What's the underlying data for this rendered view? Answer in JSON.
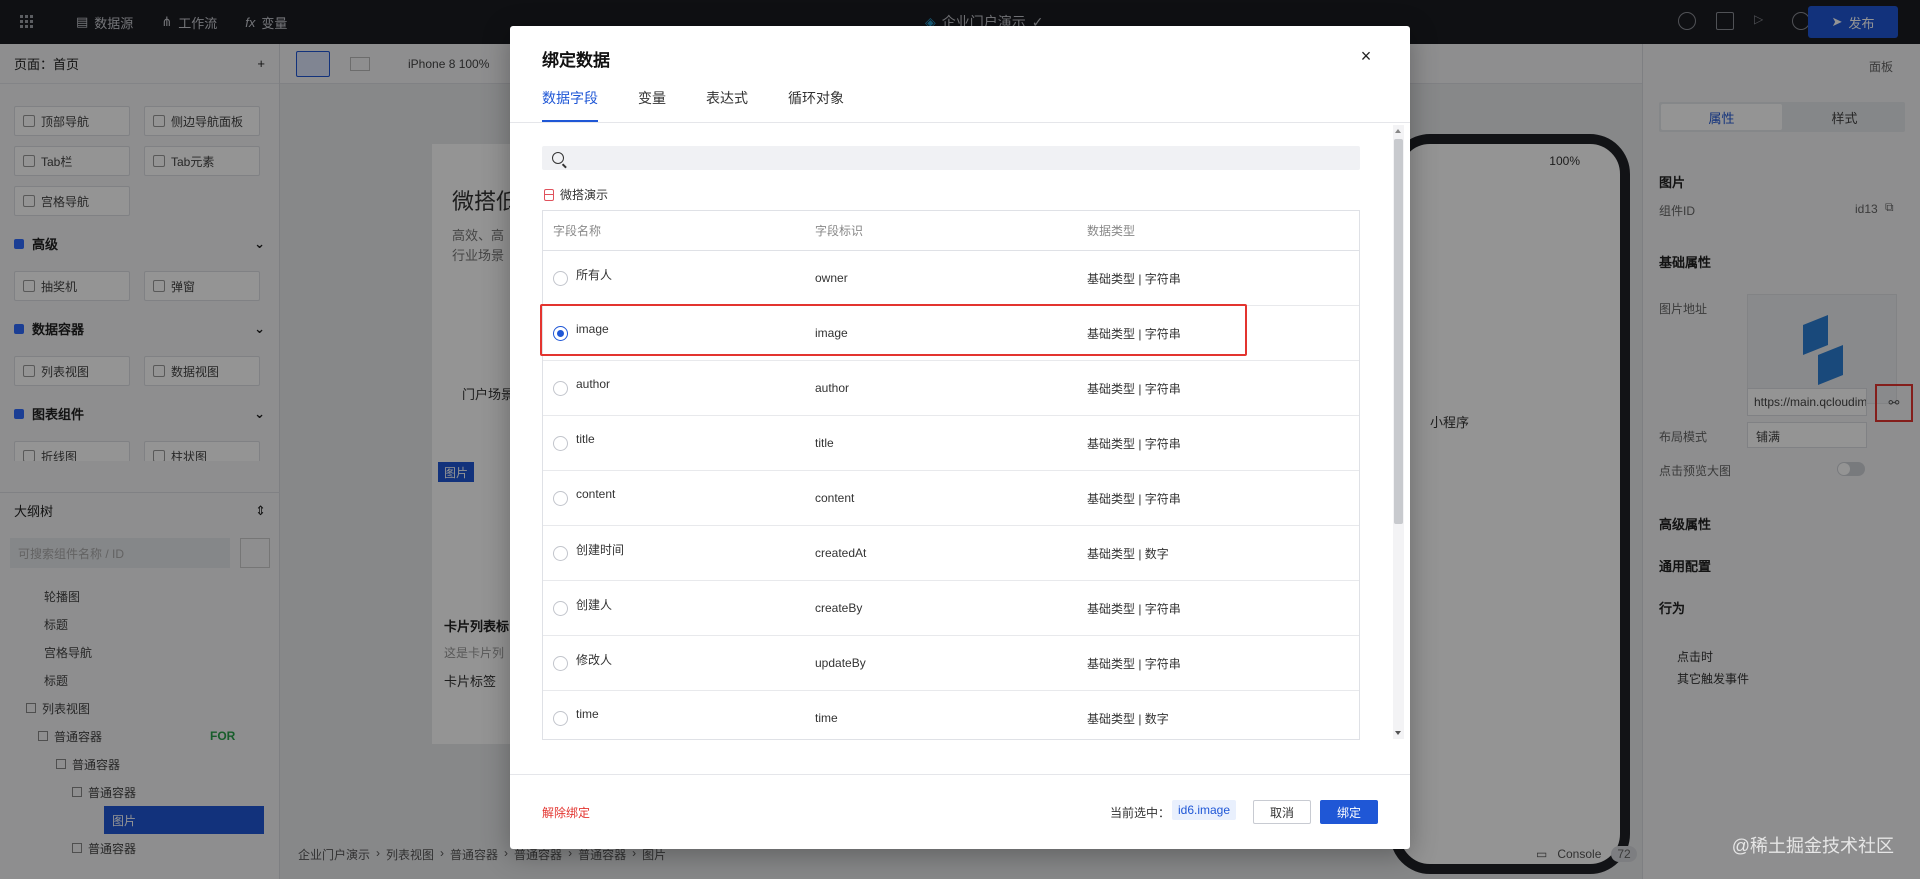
{
  "topbar": {
    "nav": [
      "数据源",
      "工作流",
      "变量"
    ],
    "app_title": "企业门户演示",
    "publish_label": "发布"
  },
  "left_panel": {
    "page_label": "页面：首页",
    "nav_components": [
      "顶部导航",
      "侧边导航面板",
      "Tab栏",
      "Tab元素",
      "宫格导航"
    ],
    "groups": [
      {
        "title": "高级",
        "items": [
          "抽奖机",
          "弹窗"
        ]
      },
      {
        "title": "数据容器",
        "items": [
          "列表视图",
          "数据视图"
        ]
      },
      {
        "title": "图表组件",
        "items": [
          "折线图",
          "柱状图"
        ]
      }
    ],
    "outline_title": "大纲树",
    "outline_search_placeholder": "可搜索组件名称 / ID",
    "tree": [
      "轮播图",
      "标题",
      "宫格导航",
      "标题",
      "列表视图",
      "普通容器",
      "普通容器",
      "普通容器",
      "图片",
      "普通容器"
    ],
    "for_tag": "FOR"
  },
  "canvas": {
    "device_label": "iPhone 8 100%",
    "hero_title": "微搭低",
    "hero_sub_1": "高效、高",
    "hero_sub_2": "行业场景",
    "portal_label": "门户场景",
    "mini_program_label": "小程序",
    "image_tag": "图片",
    "card_title": "卡片列表标",
    "card_desc": "这是卡片列",
    "card_label": "卡片标签",
    "phone_zoom": "100%"
  },
  "breadcrumb": [
    "企业门户演示",
    "列表视图",
    "普通容器",
    "普通容器",
    "普通容器",
    "图片"
  ],
  "console": {
    "label": "Console",
    "count": "72"
  },
  "right_panel": {
    "top_label": "面板",
    "tabs": [
      "属性",
      "样式"
    ],
    "section_title": "图片",
    "component_id_label": "组件ID",
    "component_id": "id13",
    "basic_props": "基础属性",
    "image_url_label": "图片地址",
    "image_url": "https://main.qcloudimg",
    "layout_mode_label": "布局模式",
    "layout_mode": "铺满",
    "preview_label": "点击预览大图",
    "advanced_props": "高级属性",
    "common_config": "通用配置",
    "behavior": "行为",
    "on_click": "点击时",
    "other_events": "其它触发事件"
  },
  "modal": {
    "title": "绑定数据",
    "close": "×",
    "tabs": [
      "数据字段",
      "变量",
      "表达式",
      "循环对象"
    ],
    "search_placeholder": "",
    "datasource_name": "微搭演示",
    "columns": [
      "字段名称",
      "字段标识",
      "数据类型"
    ],
    "rows": [
      {
        "name": "所有人",
        "id": "owner",
        "type": "基础类型 | 字符串",
        "checked": false
      },
      {
        "name": "image",
        "id": "image",
        "type": "基础类型 | 字符串",
        "checked": true
      },
      {
        "name": "author",
        "id": "author",
        "type": "基础类型 | 字符串",
        "checked": false
      },
      {
        "name": "title",
        "id": "title",
        "type": "基础类型 | 字符串",
        "checked": false
      },
      {
        "name": "content",
        "id": "content",
        "type": "基础类型 | 字符串",
        "checked": false
      },
      {
        "name": "创建时间",
        "id": "createdAt",
        "type": "基础类型 | 数字",
        "checked": false
      },
      {
        "name": "创建人",
        "id": "createBy",
        "type": "基础类型 | 字符串",
        "checked": false
      },
      {
        "name": "修改人",
        "id": "updateBy",
        "type": "基础类型 | 字符串",
        "checked": false
      },
      {
        "name": "time",
        "id": "time",
        "type": "基础类型 | 数字",
        "checked": false
      }
    ],
    "unbind_label": "解除绑定",
    "current_selected_label": "当前选中：",
    "current_selected_value": "id6.image",
    "cancel_label": "取消",
    "confirm_label": "绑定"
  },
  "watermark": "@稀土掘金技术社区"
}
